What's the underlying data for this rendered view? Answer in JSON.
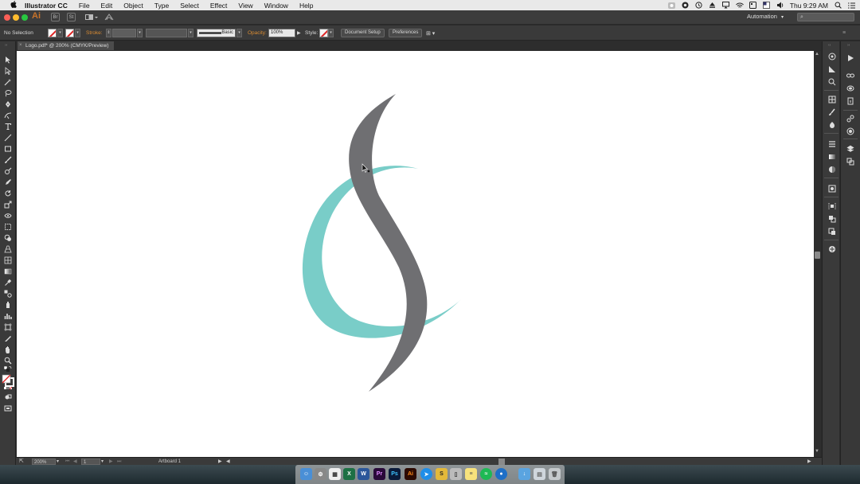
{
  "menubar": {
    "apple": "",
    "app_name": "Illustrator CC",
    "items": [
      "File",
      "Edit",
      "Object",
      "Type",
      "Select",
      "Effect",
      "View",
      "Window",
      "Help"
    ],
    "clock": "Thu 9:29 AM"
  },
  "appbar": {
    "logo": "Ai",
    "bridge_label": "Br",
    "stock_label": "St",
    "workspace": "Automation",
    "workspace_caret": "▾",
    "search_placeholder": "⌕"
  },
  "control_bar": {
    "selection_status": "No Selection",
    "stroke_label": "Stroke:",
    "brush_label": "Basic",
    "opacity_label": "Opacity:",
    "opacity_value": "100%",
    "style_label": "Style:",
    "document_setup": "Document Setup",
    "preferences": "Preferences"
  },
  "document": {
    "tab_title": "Logo.pdf* @ 200% (CMYK/Preview)",
    "close_glyph": "×"
  },
  "statusbar": {
    "zoom": "200%",
    "artboard_number": "1",
    "artboard_name": "Artboard 1"
  },
  "logo_artwork": {
    "teal_color": "#79cdc8",
    "gray_color": "#6f6f72"
  },
  "colors": {
    "menubar_bg": "#e9e9e9",
    "ui_dark": "#3a3a3a",
    "accent_orange": "#d98b32"
  }
}
